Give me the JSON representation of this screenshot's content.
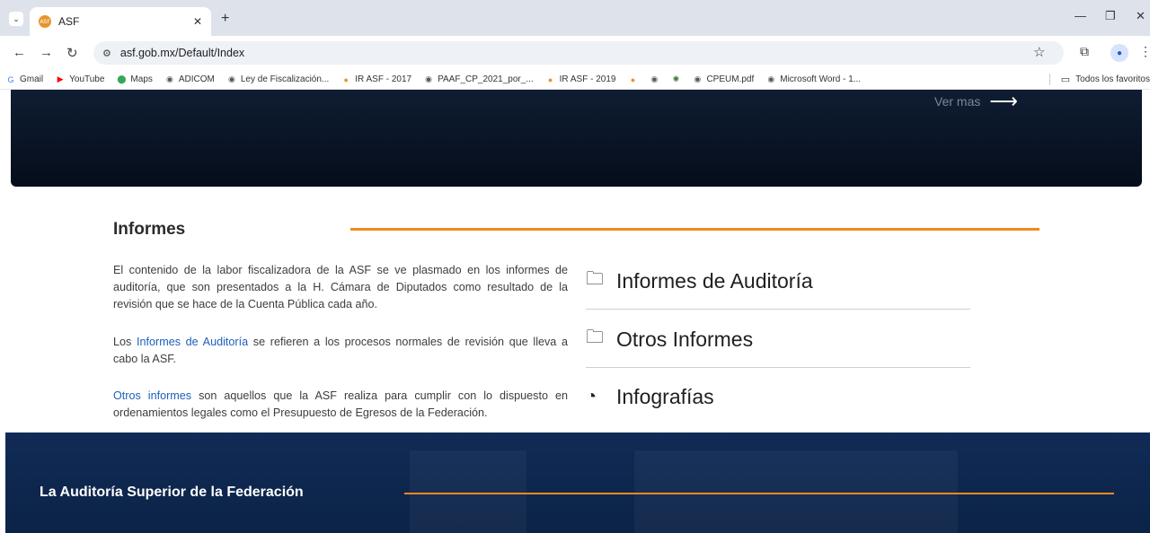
{
  "browser": {
    "tab": {
      "title": "ASF",
      "favicon_text": "ASF"
    },
    "url": "asf.gob.mx/Default/Index",
    "bookmarks": [
      {
        "label": "Gmail",
        "icon": "gmail-icon",
        "glyph": "G",
        "color": "#4285f4"
      },
      {
        "label": "YouTube",
        "icon": "youtube-icon",
        "glyph": "▶",
        "color": "#ff0000"
      },
      {
        "label": "Maps",
        "icon": "maps-icon",
        "glyph": "⬤",
        "color": "#34a853"
      },
      {
        "label": "ADICOM",
        "icon": "globe-icon",
        "glyph": "◉",
        "color": "#555555"
      },
      {
        "label": "Ley de Fiscalización...",
        "icon": "globe-icon",
        "glyph": "◉",
        "color": "#555555"
      },
      {
        "label": "IR ASF - 2017",
        "icon": "asf-icon",
        "glyph": "●",
        "color": "#e8942c"
      },
      {
        "label": "PAAF_CP_2021_por_...",
        "icon": "globe-icon",
        "glyph": "◉",
        "color": "#555555"
      },
      {
        "label": "IR ASF - 2019",
        "icon": "asf-icon",
        "glyph": "●",
        "color": "#e8942c"
      },
      {
        "label": "",
        "icon": "asf-icon",
        "glyph": "●",
        "color": "#e8942c"
      },
      {
        "label": "",
        "icon": "globe-icon",
        "glyph": "◉",
        "color": "#555555"
      },
      {
        "label": "",
        "icon": "seal-icon",
        "glyph": "✺",
        "color": "#3a7d2c"
      },
      {
        "label": "CPEUM.pdf",
        "icon": "globe-icon",
        "glyph": "◉",
        "color": "#555555"
      },
      {
        "label": "Microsoft Word - 1...",
        "icon": "globe-icon",
        "glyph": "◉",
        "color": "#555555"
      }
    ],
    "all_bookmarks": "Todos los favoritos"
  },
  "hero": {
    "link": "Ver mas"
  },
  "section": {
    "title": "Informes",
    "paragraphs": {
      "p1": "El contenido de la labor fiscalizadora de la ASF se ve plasmado en los informes de auditoría, que son presentados a la H. Cámara de Diputados como resultado de la revisión que se hace de la Cuenta Pública cada año.",
      "p2_link": "Informes de Auditoría",
      "p2_rest": " se refieren a los procesos normales de revisión que lleva a cabo la ASF.",
      "p2_prefix": "Los ",
      "p3_link": "Otros informes",
      "p3_rest": " son aquellos que la ASF realiza para cumplir con lo dispuesto en ordenamientos legales como el Presupuesto de Egresos de la Federación."
    },
    "links": [
      {
        "label": "Informes de Auditoría",
        "icon": "folder-icon"
      },
      {
        "label": "Otros Informes",
        "icon": "folder-icon"
      },
      {
        "label": "Infografías",
        "icon": "pie-chart-icon"
      }
    ]
  },
  "footer": {
    "title": "La Auditoría Superior de la Federación"
  },
  "colors": {
    "accent": "#f08a1f",
    "link": "#1e5fbb",
    "footer_bg": "#102b56",
    "hero_bg": "#060d1a"
  }
}
